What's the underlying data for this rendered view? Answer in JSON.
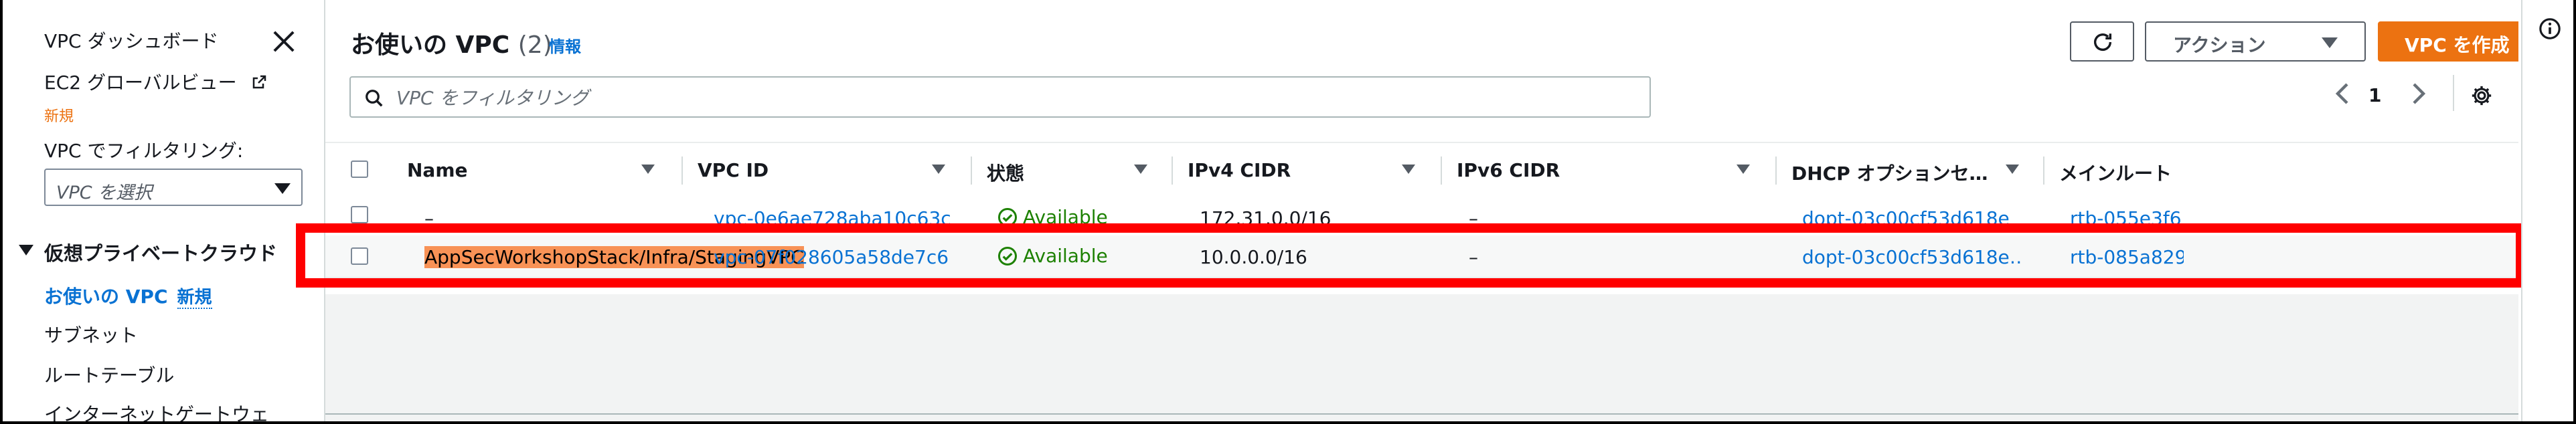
{
  "sidebar": {
    "items": {
      "dashboard": "VPC ダッシュボード",
      "ec2_global": "EC2 グローバルビュー",
      "ec2_global_tag": "新規",
      "filter_label": "VPC でフィルタリング:",
      "filter_placeholder": "VPC を選択",
      "section_title": "仮想プライベートクラウド",
      "your_vpcs": "お使いの VPC",
      "your_vpcs_tag": "新規",
      "subnets": "サブネット",
      "route_tables": "ルートテーブル",
      "igw": "インターネットゲートウェ"
    }
  },
  "header": {
    "title": "お使いの VPC",
    "count": "(2)",
    "info": "情報",
    "actions": "アクション",
    "create": "VPC を作成"
  },
  "search": {
    "placeholder": "VPC をフィルタリング"
  },
  "pagination": {
    "current": "1"
  },
  "table": {
    "columns": [
      "Name",
      "VPC ID",
      "状態",
      "IPv4 CIDR",
      "IPv6 CIDR",
      "DHCP オプションセ…",
      "メインルート"
    ],
    "rows": [
      {
        "name": "–",
        "vpc_id": "vpc-0e6ae728aba10c63c",
        "state": "Available",
        "ipv4": "172.31.0.0/16",
        "ipv6": "–",
        "dhcp": "dopt-03c00cf53d618e",
        "main_rt": "rtb-055e3f6"
      },
      {
        "name": "AppSecWorkshopStack/Infra/StagingVPC",
        "vpc_id": "vpc-07f028605a58de7c6",
        "state": "Available",
        "ipv4": "10.0.0.0/16",
        "ipv6": "–",
        "dhcp": "dopt-03c00cf53d618e…",
        "main_rt": "rtb-085a829"
      }
    ]
  },
  "colors": {
    "accent": "#0972d3",
    "primary_button": "#ec7211",
    "status_ok": "#1d8102",
    "highlight": "#f89256",
    "annotation": "#ff0000"
  },
  "icons": [
    "close-icon",
    "external-link-icon",
    "refresh-icon",
    "search-icon",
    "chevron-left-icon",
    "chevron-right-icon",
    "settings-gear-icon",
    "status-ok-icon",
    "info-icon"
  ]
}
